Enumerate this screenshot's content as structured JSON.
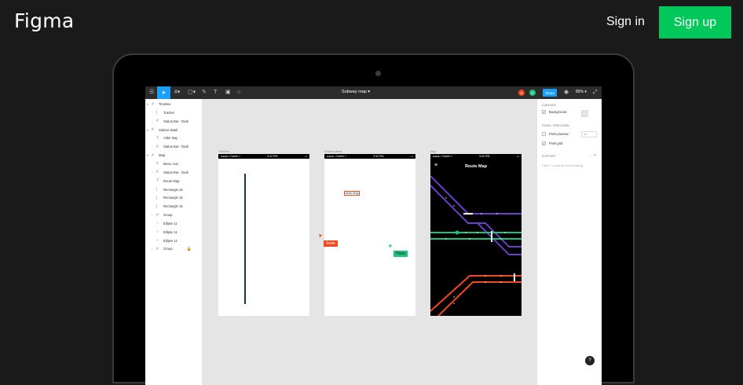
{
  "header": {
    "logo": "Figma",
    "signin_label": "Sign in",
    "signup_label": "Sign up"
  },
  "toolbar": {
    "file_title": "Subway map",
    "avatar_1": "S",
    "avatar_2": "H",
    "share_label": "Share",
    "zoom": "85%"
  },
  "layers": [
    {
      "label": "Timeline",
      "indent": 0,
      "chev": "v",
      "icon": "#"
    },
    {
      "label": "Tracker",
      "indent": 1,
      "chev": "",
      "icon": "|"
    },
    {
      "label": "Status Bar - Dark",
      "indent": 1,
      "chev": ">",
      "icon": "#"
    },
    {
      "label": "Station detail",
      "indent": 0,
      "chev": "v",
      "icon": "#"
    },
    {
      "label": "Alder Bay",
      "indent": 1,
      "chev": "",
      "icon": "T"
    },
    {
      "label": "Status Bar - Dark",
      "indent": 1,
      "chev": ">",
      "icon": "#"
    },
    {
      "label": "Map",
      "indent": 0,
      "chev": "v",
      "icon": "#"
    },
    {
      "label": "Menu icon",
      "indent": 1,
      "chev": "",
      "icon": "≡"
    },
    {
      "label": "Status Bar - Dark",
      "indent": 1,
      "chev": ">",
      "icon": "#"
    },
    {
      "label": "Route Map",
      "indent": 1,
      "chev": "",
      "icon": "T"
    },
    {
      "label": "Rectangle 15",
      "indent": 1,
      "chev": "",
      "icon": "|"
    },
    {
      "label": "Rectangle 15",
      "indent": 1,
      "chev": "",
      "icon": "|"
    },
    {
      "label": "Rectangle 15",
      "indent": 1,
      "chev": "",
      "icon": "|"
    },
    {
      "label": "Group",
      "indent": 1,
      "chev": ">",
      "icon": "#"
    },
    {
      "label": "Ellipse 11",
      "indent": 1,
      "chev": "",
      "icon": "○"
    },
    {
      "label": "Ellipse 11",
      "indent": 1,
      "chev": "",
      "icon": "○"
    },
    {
      "label": "Ellipse 11",
      "indent": 1,
      "chev": "",
      "icon": "○"
    },
    {
      "label": "Group",
      "indent": 1,
      "chev": ">",
      "icon": "#"
    }
  ],
  "props": {
    "canvas_title": "CANVAS",
    "background_label": "Background",
    "pixel_preview_title": "PIXEL PREVIEW",
    "pixel_preview_label": "Pixel preview",
    "pixel_preview_value": "1x",
    "pixel_grid_label": "Pixel grid",
    "export_title": "EXPORT",
    "export_hint": "Click + to add an export setting",
    "help": "?"
  },
  "frames": {
    "timeline": "Timeline",
    "station": "Station detail",
    "map": "Map"
  },
  "status": {
    "carrier": "●●●●○ Carrier ≈",
    "time": "9:42 PM",
    "battery": "▭"
  },
  "station_detail": {
    "alder_bay": "Alder Bay"
  },
  "map_title": "Route Map",
  "cursors": {
    "sean": "Sean",
    "hana": "Hana"
  },
  "colors": {
    "accent": "#18a0fb",
    "signup": "#00c85a",
    "purple": "#6a3fc8",
    "green": "#1bc47d",
    "orange": "#f24822"
  }
}
